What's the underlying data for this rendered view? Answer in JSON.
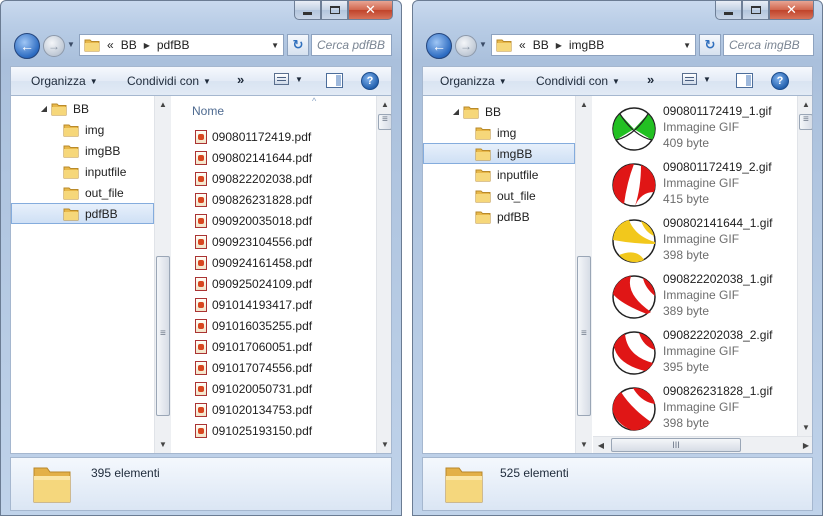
{
  "left_window": {
    "crumb_prefix": "«",
    "crumbs": [
      "BB",
      "pdfBB"
    ],
    "search_placeholder": "Cerca pdfBB",
    "commands": {
      "organize": "Organizza",
      "share": "Condividi con",
      "more": "»"
    },
    "tree": [
      {
        "label": "BB",
        "expanded": true
      },
      {
        "label": "img"
      },
      {
        "label": "imgBB"
      },
      {
        "label": "inputfile"
      },
      {
        "label": "out_file"
      },
      {
        "label": "pdfBB",
        "selected": true
      }
    ],
    "column_header": "Nome",
    "files": [
      "090801172419.pdf",
      "090802141644.pdf",
      "090822202038.pdf",
      "090826231828.pdf",
      "090920035018.pdf",
      "090923104556.pdf",
      "090924161458.pdf",
      "090925024109.pdf",
      "091014193417.pdf",
      "091016035255.pdf",
      "091017060051.pdf",
      "091017074556.pdf",
      "091020050731.pdf",
      "091020134753.pdf",
      "091025193150.pdf"
    ],
    "status": "395 elementi"
  },
  "right_window": {
    "crumb_prefix": "«",
    "crumbs": [
      "BB",
      "imgBB"
    ],
    "search_placeholder": "Cerca imgBB",
    "commands": {
      "organize": "Organizza",
      "share": "Condividi con",
      "more": "»"
    },
    "tree": [
      {
        "label": "BB",
        "expanded": true
      },
      {
        "label": "img"
      },
      {
        "label": "imgBB",
        "selected": true
      },
      {
        "label": "inputfile"
      },
      {
        "label": "out_file"
      },
      {
        "label": "pdfBB"
      }
    ],
    "tiles": [
      {
        "name": "090801172419_1.gif",
        "type": "Immagine GIF",
        "size": "409 byte",
        "color": "#22c022"
      },
      {
        "name": "090801172419_2.gif",
        "type": "Immagine GIF",
        "size": "415 byte",
        "color": "#e01616"
      },
      {
        "name": "090802141644_1.gif",
        "type": "Immagine GIF",
        "size": "398 byte",
        "color": "#f2c81c"
      },
      {
        "name": "090822202038_1.gif",
        "type": "Immagine GIF",
        "size": "389 byte",
        "color": "#e01616"
      },
      {
        "name": "090822202038_2.gif",
        "type": "Immagine GIF",
        "size": "395 byte",
        "color": "#e01616"
      },
      {
        "name": "090826231828_1.gif",
        "type": "Immagine GIF",
        "size": "398 byte",
        "color": "#e01616"
      }
    ],
    "status": "525 elementi"
  },
  "scroll": {
    "h_thumb_glyph": "III"
  }
}
